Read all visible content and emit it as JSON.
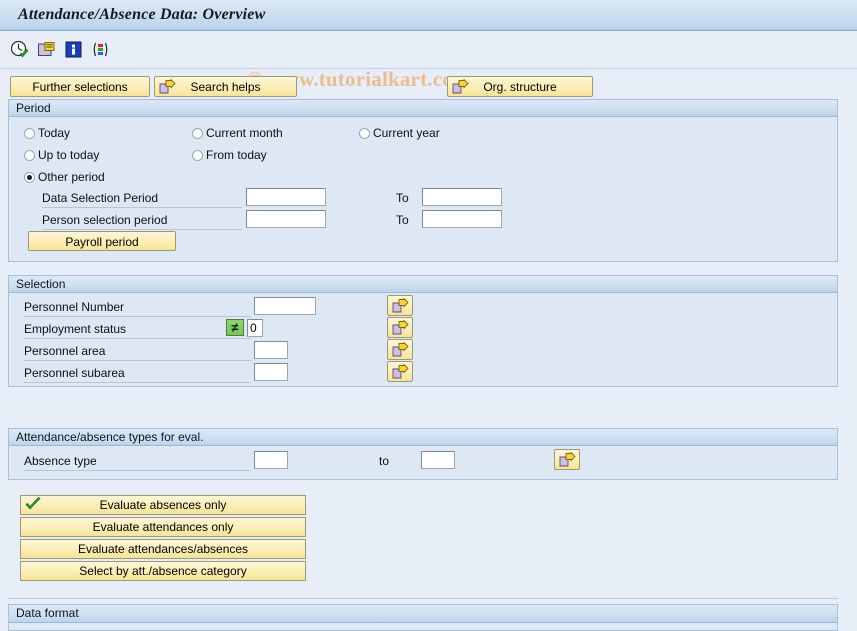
{
  "window": {
    "title": "Attendance/Absence Data: Overview"
  },
  "watermark": "© www.tutorialkart.com",
  "toolbar": {
    "icons": [
      {
        "name": "execute-clock-icon",
        "label": "Execute"
      },
      {
        "name": "get-variant-icon",
        "label": "Get Variant"
      },
      {
        "name": "info-icon",
        "label": "Information"
      },
      {
        "name": "color-legend-icon",
        "label": "Legend"
      }
    ]
  },
  "actions": {
    "further_selections": "Further selections",
    "search_helps": "Search helps",
    "org_structure": "Org. structure",
    "payroll_period": "Payroll period"
  },
  "period": {
    "section_title": "Period",
    "radios": [
      {
        "label": "Today",
        "checked": false
      },
      {
        "label": "Current month",
        "checked": false
      },
      {
        "label": "Current year",
        "checked": false
      },
      {
        "label": "Up to today",
        "checked": false
      },
      {
        "label": "From today",
        "checked": false
      },
      {
        "label": "Other period",
        "checked": true
      }
    ],
    "rows": [
      {
        "label": "Data Selection Period",
        "from_value": "",
        "to_label": "To",
        "to_value": ""
      },
      {
        "label": "Person selection period",
        "from_value": "",
        "to_label": "To",
        "to_value": ""
      }
    ]
  },
  "selection": {
    "section_title": "Selection",
    "rows": [
      {
        "label": "Personnel Number",
        "value": "",
        "has_operator": false,
        "multi_select": true
      },
      {
        "label": "Employment status",
        "value": "0",
        "has_operator": true,
        "operator": "≠",
        "multi_select": true
      },
      {
        "label": "Personnel area",
        "value": "",
        "has_operator": false,
        "multi_select": true
      },
      {
        "label": "Personnel subarea",
        "value": "",
        "has_operator": false,
        "multi_select": true
      }
    ]
  },
  "att_abs": {
    "section_title": "Attendance/absence types for eval.",
    "row": {
      "label": "Absence type",
      "from_value": "",
      "to_label": "to",
      "to_value": ""
    }
  },
  "evaluate_buttons": [
    {
      "label": "Evaluate absences only",
      "checked": true
    },
    {
      "label": "Evaluate attendances only",
      "checked": false
    },
    {
      "label": "Evaluate attendances/absences",
      "checked": false
    },
    {
      "label": "Select by att./absence category",
      "checked": false
    }
  ],
  "data_format": {
    "section_title": "Data format"
  },
  "colors": {
    "window_bg": "#e8eef7",
    "panel_bg": "#dee8f4",
    "panel_border": "#a8c0da",
    "button_yellow": "#fbeeb6",
    "accent_blue": "#bcd4ec",
    "watermark": "#e8b98a",
    "operator_green": "#79c25c"
  }
}
